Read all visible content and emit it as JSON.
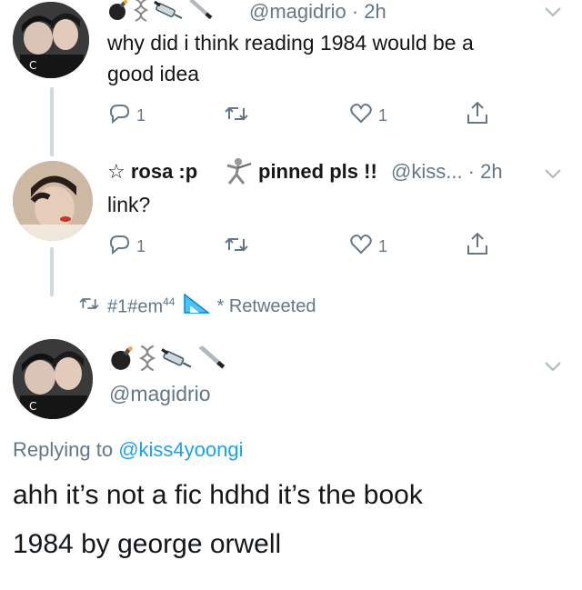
{
  "tweet1": {
    "handle_time": "@magidrio · 2h",
    "text_line1": "why did i think reading 1984 would be a",
    "text_line2": "good idea",
    "reply_count": "1",
    "like_count": "1"
  },
  "tweet2": {
    "name_left": "☆ rosa :p",
    "name_right": "pinned pls !!",
    "handle_time": "@kiss... · 2h",
    "text": "link?",
    "reply_count": "1",
    "like_count": "1"
  },
  "retweet_bar": {
    "tag": "#1#em",
    "superscript": "44",
    "label": "* Retweeted"
  },
  "main_tweet": {
    "handle": "@magidrio",
    "replying_prefix": "Replying to",
    "replying_handle": "@kiss4yoongi",
    "text_line1": "ahh it’s not a fic hdhd it’s the book",
    "text_line2": "1984 by george orwell"
  },
  "icons": [
    "bomb-icon",
    "dna-icon",
    "syringe-icon",
    "knife-icon",
    "fencer-icon",
    "ruler-icon",
    "reply-icon",
    "retweet-icon",
    "like-icon",
    "share-icon",
    "chevron-down-icon"
  ],
  "colors": {
    "muted": "#657786",
    "link": "#1da1f2",
    "text": "#14171a",
    "thread_line": "#cfd9de"
  }
}
